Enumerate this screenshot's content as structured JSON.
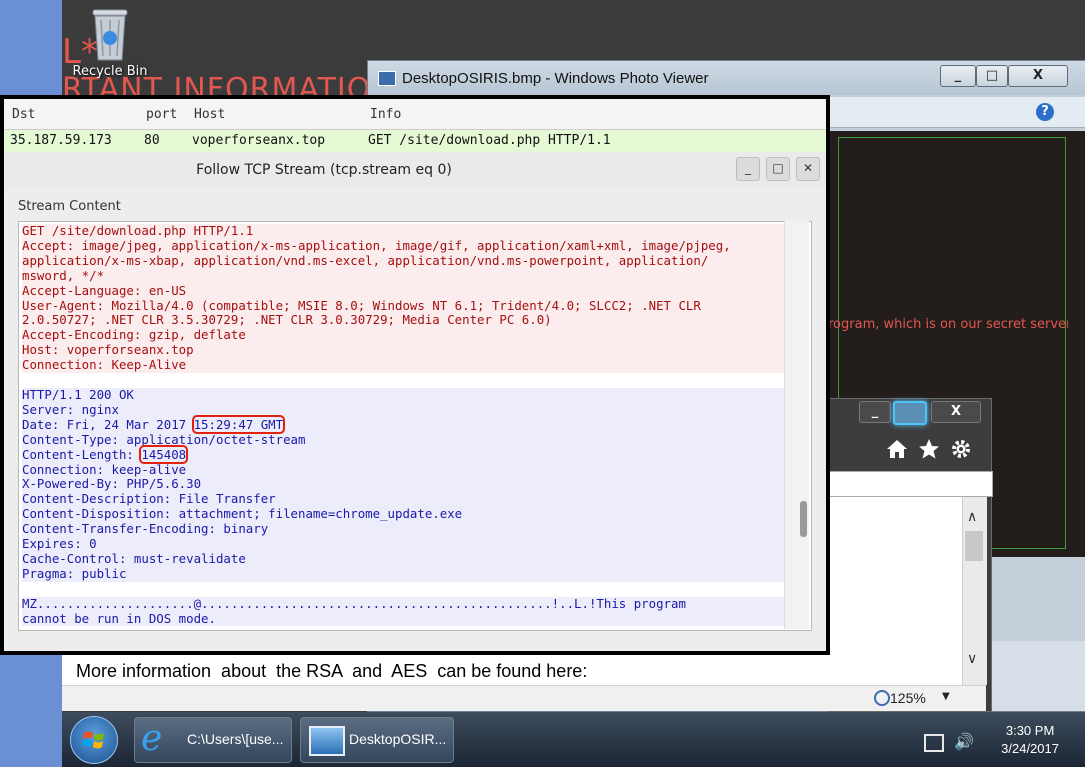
{
  "desktop": {
    "recycle_bin_label": "Recycle Bin",
    "background_text_1": "RTANT INFORMATION !",
    "background_text_2": "rogram, which is on our secret server.",
    "background_fragment": "L*",
    "bottom_note": "More information  about  the RSA  and  AES  can be found here:"
  },
  "photo_viewer": {
    "title": "DesktopOSIRIS.bmp - Windows Photo Viewer",
    "minimize": "_",
    "maximize": "□",
    "close": "X",
    "help_icon": "?"
  },
  "note_window": {
    "zoom": "125%",
    "minimize": "_",
    "close": "X"
  },
  "wireshark": {
    "columns": [
      "Dst",
      "port",
      "Host",
      "Info"
    ],
    "row": {
      "dst": "35.187.59.173",
      "port": "80",
      "host": "voperforseanx.top",
      "info": "GET /site/download.php HTTP/1.1"
    },
    "dialog_title": "Follow TCP Stream (tcp.stream eq 0)",
    "stream_label": "Stream Content",
    "request_lines": [
      "GET /site/download.php HTTP/1.1",
      "Accept: image/jpeg, application/x-ms-application, image/gif, application/xaml+xml, image/pjpeg,",
      "application/x-ms-xbap, application/vnd.ms-excel, application/vnd.ms-powerpoint, application/",
      "msword, */*",
      "Accept-Language: en-US",
      "User-Agent: Mozilla/4.0 (compatible; MSIE 8.0; Windows NT 6.1; Trident/4.0; SLCC2; .NET CLR",
      "2.0.50727; .NET CLR 3.5.30729; .NET CLR 3.0.30729; Media Center PC 6.0)",
      "Accept-Encoding: gzip, deflate",
      "Host: voperforseanx.top",
      "Connection: Keep-Alive"
    ],
    "response_lines": [
      "HTTP/1.1 200 OK",
      "Server: nginx"
    ],
    "date_prefix": "Date: Fri, 24 Mar 2017 ",
    "date_time": "15:29:47 GMT",
    "content_type": "Content-Type: application/octet-stream",
    "content_length_prefix": "Content-Length: ",
    "content_length_value": "145408",
    "response_lines_2": [
      "Connection: keep-alive",
      "X-Powered-By: PHP/5.6.30",
      "Content-Description: File Transfer",
      "Content-Disposition: attachment; filename=chrome_update.exe",
      "Content-Transfer-Encoding: binary",
      "Expires: 0",
      "Cache-Control: must-revalidate",
      "Pragma: public"
    ],
    "payload_lines": [
      "MZ.....................@...............................................!..L.!This program",
      "cannot be run in DOS mode."
    ]
  },
  "taskbar": {
    "ie_label": "C:\\Users\\[use...",
    "photo_label": "DesktopOSIR...",
    "time": "3:30 PM",
    "date": "3/24/2017"
  },
  "colors": {
    "request_text": "#a60f0f",
    "response_text": "#1a1aa8",
    "highlight_box": "#e3210f",
    "ransom_red": "#e2574f"
  }
}
